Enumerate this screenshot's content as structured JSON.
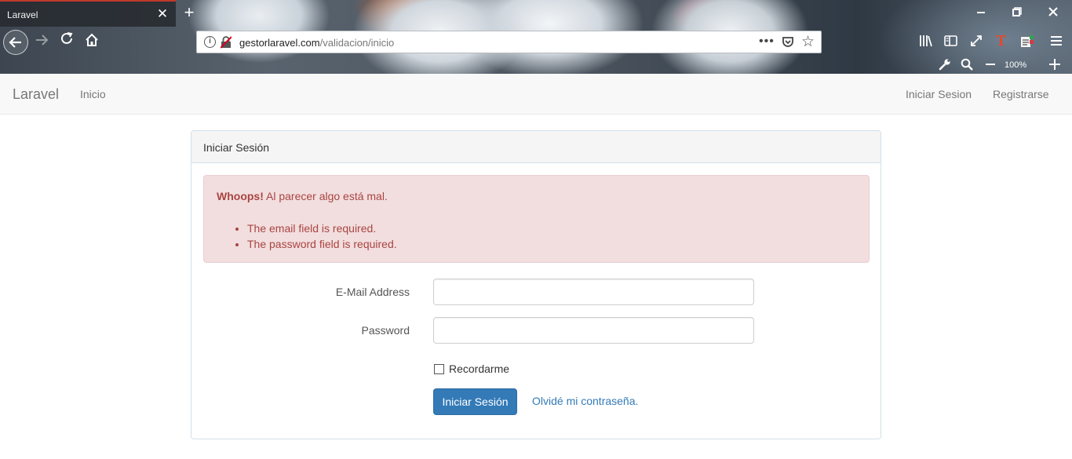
{
  "browser": {
    "tab_title": "Laravel",
    "tab_close_glyph": "✕",
    "new_tab_glyph": "+",
    "url_domain": "gestorlaravel.com",
    "url_path": "/validacion/inicio",
    "url_more_glyph": "•••",
    "zoom_level": "100%",
    "icons": [
      "back-arrow-icon",
      "forward-arrow-icon",
      "reload-icon",
      "home-icon",
      "info-icon",
      "insecure-lock-icon",
      "page-actions-icon",
      "pocket-icon",
      "bookmark-star-icon",
      "library-icon",
      "sidebar-icon",
      "fullscreen-icon",
      "extension-t-icon",
      "extension-reader-icon",
      "menu-icon",
      "wrench-icon",
      "zoom-search-icon",
      "zoom-out-icon",
      "zoom-in-icon",
      "minimize-icon",
      "restore-icon",
      "close-window-icon"
    ]
  },
  "navbar": {
    "brand": "Laravel",
    "links_left": [
      "Inicio"
    ],
    "links_right": [
      "Iniciar Sesion",
      "Registrarse"
    ]
  },
  "panel": {
    "heading": "Iniciar Sesión"
  },
  "alert": {
    "strong": "Whoops!",
    "message": " Al parecer algo está mal.",
    "errors": [
      "The email field is required.",
      "The password field is required."
    ],
    "color_text": "#a94442",
    "color_bg": "#f2dede"
  },
  "form": {
    "email_label": "E-Mail Address",
    "email_value": "",
    "password_label": "Password",
    "password_value": "",
    "remember_label": "Recordarme",
    "remember_checked": false,
    "submit_label": "Iniciar Sesión",
    "forgot_link": "Olvidé mi contraseña."
  },
  "colors": {
    "primary": "#337ab7",
    "link": "#337ab7",
    "navbar_bg": "#f8f8f8"
  }
}
